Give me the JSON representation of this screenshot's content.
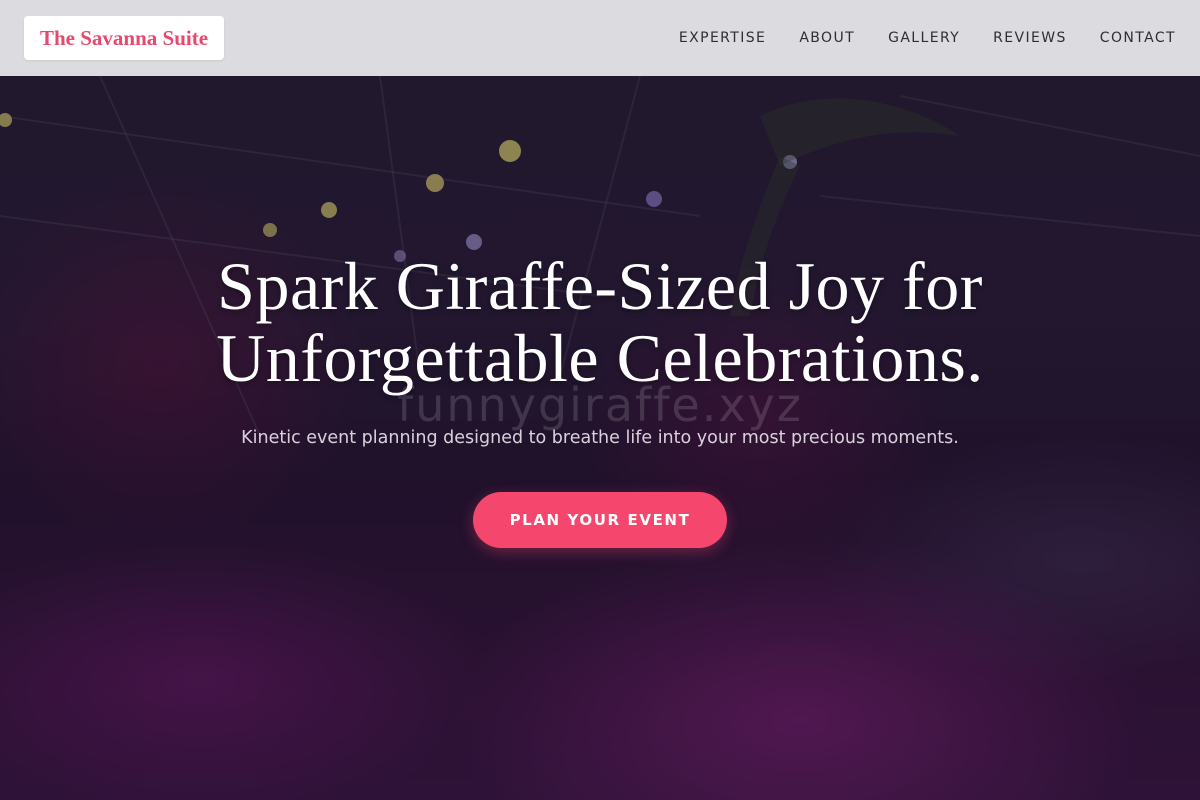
{
  "brand": {
    "name": "The Savanna Suite"
  },
  "nav": {
    "items": [
      "EXPERTISE",
      "ABOUT",
      "GALLERY",
      "REVIEWS",
      "CONTACT"
    ]
  },
  "hero": {
    "title_line1": "Spark Giraffe-Sized Joy for",
    "title_line2": "Unforgettable Celebrations.",
    "watermark": "funnygiraffe.xyz",
    "subtitle": "Kinetic event planning designed to breathe life into your most precious moments.",
    "cta_label": "PLAN YOUR EVENT"
  },
  "colors": {
    "accent": "#f5476d",
    "brand_text": "#e8486e",
    "header_bg": "#e8e8eb"
  }
}
